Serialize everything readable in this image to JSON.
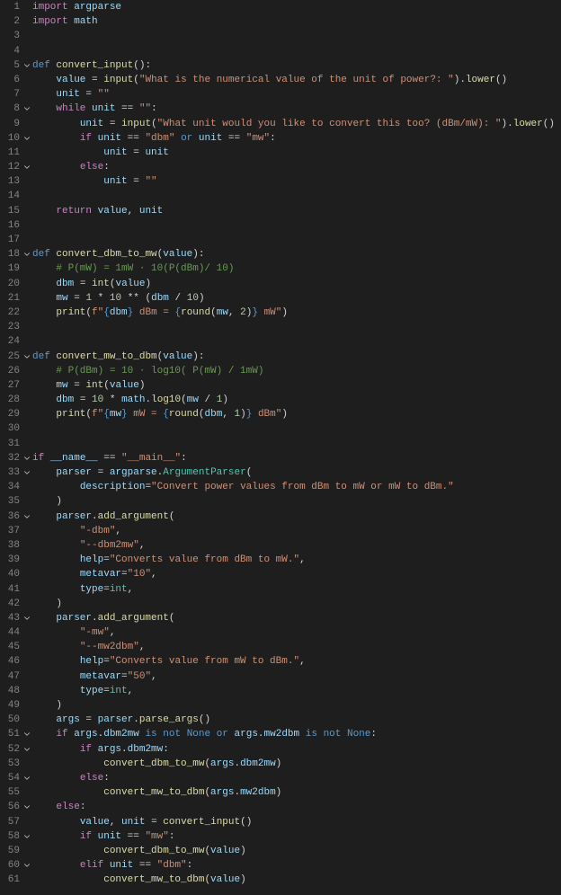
{
  "file": "python",
  "lines": [
    {
      "n": 1,
      "fold": false,
      "html": "<span class='cf'>import</span> <span class='var'>argparse</span>"
    },
    {
      "n": 2,
      "fold": false,
      "html": "<span class='cf'>import</span> <span class='var'>math</span>"
    },
    {
      "n": 3,
      "fold": false,
      "html": ""
    },
    {
      "n": 4,
      "fold": false,
      "html": ""
    },
    {
      "n": 5,
      "fold": true,
      "html": "<span class='kw'>def</span> <span class='fn'>convert_input</span><span class='pn'>():</span>"
    },
    {
      "n": 6,
      "fold": false,
      "html": "    <span class='var'>value</span> <span class='op'>=</span> <span class='bi'>input</span><span class='pn'>(</span><span class='str'>\"What is the numerical value of the unit of power?: \"</span><span class='pn'>).</span><span class='fn'>lower</span><span class='pn'>()</span>"
    },
    {
      "n": 7,
      "fold": false,
      "html": "    <span class='var'>unit</span> <span class='op'>=</span> <span class='str'>\"\"</span>"
    },
    {
      "n": 8,
      "fold": true,
      "html": "    <span class='cf'>while</span> <span class='var'>unit</span> <span class='op'>==</span> <span class='str'>\"\"</span><span class='pn'>:</span>"
    },
    {
      "n": 9,
      "fold": false,
      "html": "        <span class='var'>unit</span> <span class='op'>=</span> <span class='bi'>input</span><span class='pn'>(</span><span class='str'>\"What unit would you like to convert this too? (dBm/mW): \"</span><span class='pn'>).</span><span class='fn'>lower</span><span class='pn'>()</span>"
    },
    {
      "n": 10,
      "fold": true,
      "html": "        <span class='cf'>if</span> <span class='var'>unit</span> <span class='op'>==</span> <span class='str'>\"dbm\"</span> <span class='kw'>or</span> <span class='var'>unit</span> <span class='op'>==</span> <span class='str'>\"mw\"</span><span class='pn'>:</span>"
    },
    {
      "n": 11,
      "fold": false,
      "html": "            <span class='var'>unit</span> <span class='op'>=</span> <span class='var'>unit</span>"
    },
    {
      "n": 12,
      "fold": true,
      "html": "        <span class='cf'>else</span><span class='pn'>:</span>"
    },
    {
      "n": 13,
      "fold": false,
      "html": "            <span class='var'>unit</span> <span class='op'>=</span> <span class='str'>\"\"</span>"
    },
    {
      "n": 14,
      "fold": false,
      "html": ""
    },
    {
      "n": 15,
      "fold": false,
      "html": "    <span class='cf'>return</span> <span class='var'>value</span><span class='pn'>,</span> <span class='var'>unit</span>"
    },
    {
      "n": 16,
      "fold": false,
      "html": ""
    },
    {
      "n": 17,
      "fold": false,
      "html": ""
    },
    {
      "n": 18,
      "fold": true,
      "html": "<span class='kw'>def</span> <span class='fn'>convert_dbm_to_mw</span><span class='pn'>(</span><span class='var'>value</span><span class='pn'>):</span>"
    },
    {
      "n": 19,
      "fold": false,
      "html": "    <span class='cm'># P(mW) = 1mW · 10(P(dBm)/ 10)</span>"
    },
    {
      "n": 20,
      "fold": false,
      "html": "    <span class='var'>dbm</span> <span class='op'>=</span> <span class='bi'>int</span><span class='pn'>(</span><span class='var'>value</span><span class='pn'>)</span>"
    },
    {
      "n": 21,
      "fold": false,
      "html": "    <span class='var'>mw</span> <span class='op'>=</span> <span class='num'>1</span> <span class='op'>*</span> <span class='num'>10</span> <span class='op'>**</span> <span class='pn'>(</span><span class='var'>dbm</span> <span class='op'>/</span> <span class='num'>10</span><span class='pn'>)</span>"
    },
    {
      "n": 22,
      "fold": false,
      "html": "    <span class='bi'>print</span><span class='pn'>(</span><span class='str'>f\"</span><span class='kw'>{</span><span class='var'>dbm</span><span class='kw'>}</span><span class='str'> dBm = </span><span class='kw'>{</span><span class='bi'>round</span><span class='pn'>(</span><span class='var'>mw</span><span class='pn'>,</span> <span class='num'>2</span><span class='pn'>)</span><span class='kw'>}</span><span class='str'> mW\"</span><span class='pn'>)</span>"
    },
    {
      "n": 23,
      "fold": false,
      "html": ""
    },
    {
      "n": 24,
      "fold": false,
      "html": ""
    },
    {
      "n": 25,
      "fold": true,
      "html": "<span class='kw'>def</span> <span class='fn'>convert_mw_to_dbm</span><span class='pn'>(</span><span class='var'>value</span><span class='pn'>):</span>"
    },
    {
      "n": 26,
      "fold": false,
      "html": "    <span class='cm'># P(dBm) = 10 · log10( P(mW) / 1mW)</span>"
    },
    {
      "n": 27,
      "fold": false,
      "html": "    <span class='var'>mw</span> <span class='op'>=</span> <span class='bi'>int</span><span class='pn'>(</span><span class='var'>value</span><span class='pn'>)</span>"
    },
    {
      "n": 28,
      "fold": false,
      "html": "    <span class='var'>dbm</span> <span class='op'>=</span> <span class='num'>10</span> <span class='op'>*</span> <span class='var'>math</span><span class='pn'>.</span><span class='fn'>log10</span><span class='pn'>(</span><span class='var'>mw</span> <span class='op'>/</span> <span class='num'>1</span><span class='pn'>)</span>"
    },
    {
      "n": 29,
      "fold": false,
      "html": "    <span class='bi'>print</span><span class='pn'>(</span><span class='str'>f\"</span><span class='kw'>{</span><span class='var'>mw</span><span class='kw'>}</span><span class='str'> mW = </span><span class='kw'>{</span><span class='bi'>round</span><span class='pn'>(</span><span class='var'>dbm</span><span class='pn'>,</span> <span class='num'>1</span><span class='pn'>)</span><span class='kw'>}</span><span class='str'> dBm\"</span><span class='pn'>)</span>"
    },
    {
      "n": 30,
      "fold": false,
      "html": ""
    },
    {
      "n": 31,
      "fold": false,
      "html": ""
    },
    {
      "n": 32,
      "fold": true,
      "html": "<span class='cf'>if</span> <span class='var'>__name__</span> <span class='op'>==</span> <span class='str'>\"__main__\"</span><span class='pn'>:</span>"
    },
    {
      "n": 33,
      "fold": true,
      "html": "    <span class='var'>parser</span> <span class='op'>=</span> <span class='var'>argparse</span><span class='pn'>.</span><span class='cls'>ArgumentParser</span><span class='pn'>(</span>"
    },
    {
      "n": 34,
      "fold": false,
      "html": "        <span class='var'>description</span><span class='op'>=</span><span class='str'>\"Convert power values from dBm to mW or mW to dBm.\"</span>"
    },
    {
      "n": 35,
      "fold": false,
      "html": "    <span class='pn'>)</span>"
    },
    {
      "n": 36,
      "fold": true,
      "html": "    <span class='var'>parser</span><span class='pn'>.</span><span class='fn'>add_argument</span><span class='pn'>(</span>"
    },
    {
      "n": 37,
      "fold": false,
      "html": "        <span class='str'>\"-dbm\"</span><span class='pn'>,</span>"
    },
    {
      "n": 38,
      "fold": false,
      "html": "        <span class='str'>\"--dbm2mw\"</span><span class='pn'>,</span>"
    },
    {
      "n": 39,
      "fold": false,
      "html": "        <span class='var'>help</span><span class='op'>=</span><span class='str'>\"Converts value from dBm to mW.\"</span><span class='pn'>,</span>"
    },
    {
      "n": 40,
      "fold": false,
      "html": "        <span class='var'>metavar</span><span class='op'>=</span><span class='str'>\"10\"</span><span class='pn'>,</span>"
    },
    {
      "n": 41,
      "fold": false,
      "html": "        <span class='var'>type</span><span class='op'>=</span><span class='cls'>int</span><span class='pn'>,</span>"
    },
    {
      "n": 42,
      "fold": false,
      "html": "    <span class='pn'>)</span>"
    },
    {
      "n": 43,
      "fold": true,
      "html": "    <span class='var'>parser</span><span class='pn'>.</span><span class='fn'>add_argument</span><span class='pn'>(</span>"
    },
    {
      "n": 44,
      "fold": false,
      "html": "        <span class='str'>\"-mw\"</span><span class='pn'>,</span>"
    },
    {
      "n": 45,
      "fold": false,
      "html": "        <span class='str'>\"--mw2dbm\"</span><span class='pn'>,</span>"
    },
    {
      "n": 46,
      "fold": false,
      "html": "        <span class='var'>help</span><span class='op'>=</span><span class='str'>\"Converts value from mW to dBm.\"</span><span class='pn'>,</span>"
    },
    {
      "n": 47,
      "fold": false,
      "html": "        <span class='var'>metavar</span><span class='op'>=</span><span class='str'>\"50\"</span><span class='pn'>,</span>"
    },
    {
      "n": 48,
      "fold": false,
      "html": "        <span class='var'>type</span><span class='op'>=</span><span class='cls'>int</span><span class='pn'>,</span>"
    },
    {
      "n": 49,
      "fold": false,
      "html": "    <span class='pn'>)</span>"
    },
    {
      "n": 50,
      "fold": false,
      "html": "    <span class='var'>args</span> <span class='op'>=</span> <span class='var'>parser</span><span class='pn'>.</span><span class='fn'>parse_args</span><span class='pn'>()</span>"
    },
    {
      "n": 51,
      "fold": true,
      "html": "    <span class='cf'>if</span> <span class='var'>args</span><span class='pn'>.</span><span class='var'>dbm2mw</span> <span class='kw'>is</span> <span class='kw'>not</span> <span class='cn'>None</span> <span class='kw'>or</span> <span class='var'>args</span><span class='pn'>.</span><span class='var'>mw2dbm</span> <span class='kw'>is</span> <span class='kw'>not</span> <span class='cn'>None</span><span class='pn'>:</span>"
    },
    {
      "n": 52,
      "fold": true,
      "html": "        <span class='cf'>if</span> <span class='var'>args</span><span class='pn'>.</span><span class='var'>dbm2mw</span><span class='pn'>:</span>"
    },
    {
      "n": 53,
      "fold": false,
      "html": "            <span class='fn'>convert_dbm_to_mw</span><span class='pn'>(</span><span class='var'>args</span><span class='pn'>.</span><span class='var'>dbm2mw</span><span class='pn'>)</span>"
    },
    {
      "n": 54,
      "fold": true,
      "html": "        <span class='cf'>else</span><span class='pn'>:</span>"
    },
    {
      "n": 55,
      "fold": false,
      "html": "            <span class='fn'>convert_mw_to_dbm</span><span class='pn'>(</span><span class='var'>args</span><span class='pn'>.</span><span class='var'>mw2dbm</span><span class='pn'>)</span>"
    },
    {
      "n": 56,
      "fold": true,
      "html": "    <span class='cf'>else</span><span class='pn'>:</span>"
    },
    {
      "n": 57,
      "fold": false,
      "html": "        <span class='var'>value</span><span class='pn'>,</span> <span class='var'>unit</span> <span class='op'>=</span> <span class='fn'>convert_input</span><span class='pn'>()</span>"
    },
    {
      "n": 58,
      "fold": true,
      "html": "        <span class='cf'>if</span> <span class='var'>unit</span> <span class='op'>==</span> <span class='str'>\"mw\"</span><span class='pn'>:</span>"
    },
    {
      "n": 59,
      "fold": false,
      "html": "            <span class='fn'>convert_dbm_to_mw</span><span class='pn'>(</span><span class='var'>value</span><span class='pn'>)</span>"
    },
    {
      "n": 60,
      "fold": true,
      "html": "        <span class='cf'>elif</span> <span class='var'>unit</span> <span class='op'>==</span> <span class='str'>\"dbm\"</span><span class='pn'>:</span>"
    },
    {
      "n": 61,
      "fold": false,
      "html": "            <span class='fn'>convert_mw_to_dbm</span><span class='pn'>(</span><span class='var'>value</span><span class='pn'>)</span>"
    }
  ]
}
